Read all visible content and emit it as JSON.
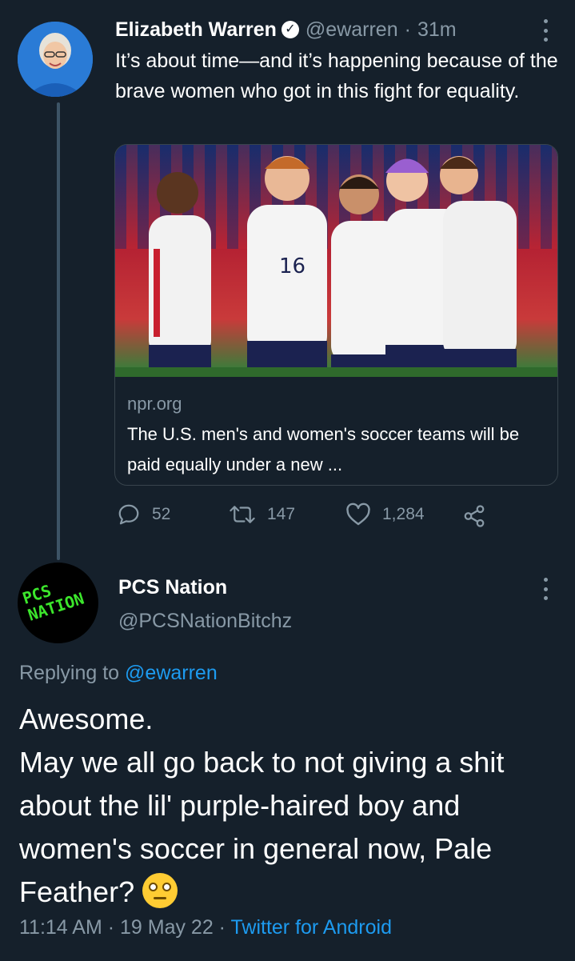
{
  "original_tweet": {
    "author_name": "Elizabeth Warren",
    "handle": "@ewarren",
    "separator": "·",
    "time_ago": "31m",
    "verified_icon": "verified-badge-icon",
    "text": "It’s about time—and it’s happening because of the brave women who got in this fight for equality.",
    "card": {
      "domain": "npr.org",
      "title": "The U.S. men's and women's soccer teams will be paid equally under a new ..."
    },
    "actions": {
      "replies": "52",
      "retweets": "147",
      "likes": "1,284"
    }
  },
  "reply_tweet": {
    "author_name": "PCS Nation",
    "handle": "@PCSNationBitchz",
    "avatar_text": "PCS NATION",
    "replying_to_prefix": "Replying to",
    "replying_to_handle": "@ewarren",
    "text_line1": "Awesome.",
    "text_body": "May we all go back to not giving a shit about the lil' purple-haired boy and women's soccer in general now, Pale Feather?",
    "emoji": "face-with-rolling-eyes",
    "timestamp": "11:14 AM · 19 May 22 · ",
    "source": "Twitter for Android"
  },
  "colors": {
    "background": "#15202b",
    "text": "#ffffff",
    "muted": "#8899a6",
    "link": "#1d9bf0",
    "border": "#38444d"
  }
}
